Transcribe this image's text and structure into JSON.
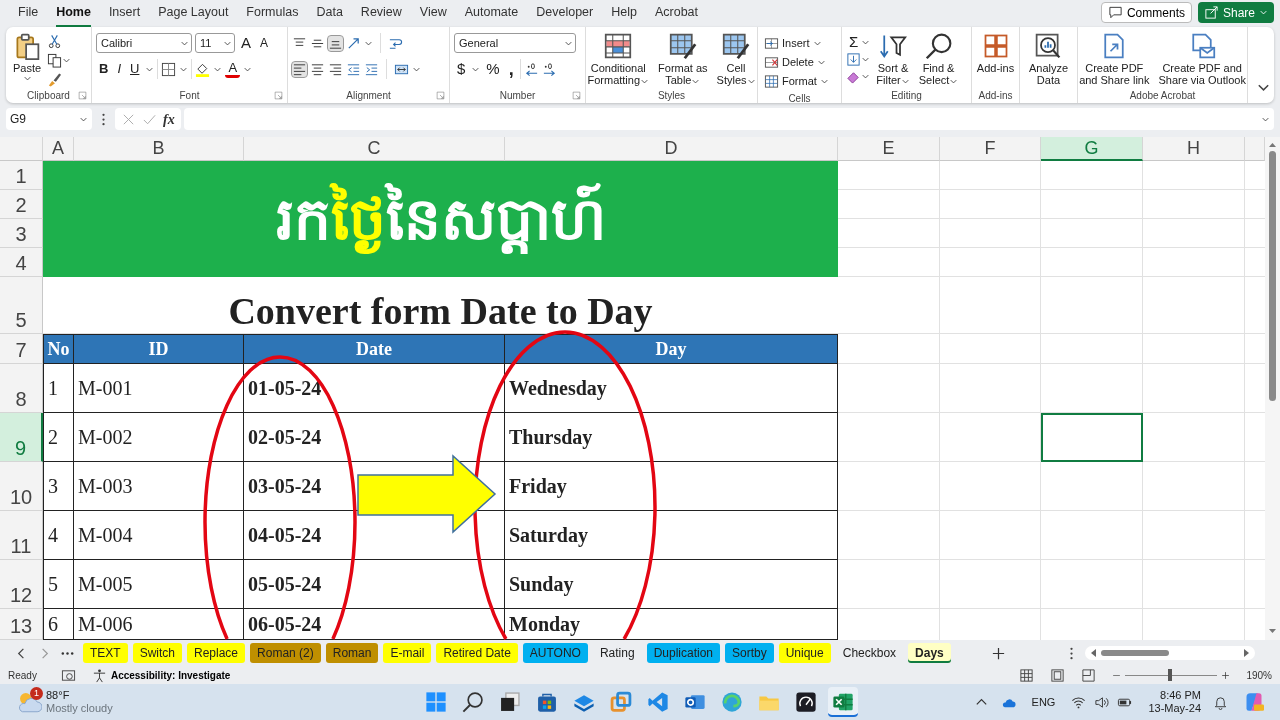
{
  "menu_tabs": [
    {
      "label": "File",
      "selected": false
    },
    {
      "label": "Home",
      "selected": true
    },
    {
      "label": "Insert",
      "selected": false
    },
    {
      "label": "Page Layout",
      "selected": false
    },
    {
      "label": "Formulas",
      "selected": false
    },
    {
      "label": "Data",
      "selected": false
    },
    {
      "label": "Review",
      "selected": false
    },
    {
      "label": "View",
      "selected": false
    },
    {
      "label": "Automate",
      "selected": false
    },
    {
      "label": "Developer",
      "selected": false
    },
    {
      "label": "Help",
      "selected": false
    },
    {
      "label": "Acrobat",
      "selected": false
    }
  ],
  "header_buttons": {
    "comments": "Comments",
    "share": "Share"
  },
  "ribbon": {
    "clipboard": {
      "paste": "Paste",
      "label": "Clipboard"
    },
    "font": {
      "name": "Calibri",
      "size": "11",
      "grow": "A",
      "shrink": "A",
      "bold": "B",
      "italic": "I",
      "underline": "U",
      "font_color_button": "A",
      "label": "Font"
    },
    "alignment": {
      "vertical": [
        {
          "selected": false
        },
        {
          "selected": false
        },
        {
          "selected": true
        }
      ],
      "horizontal": [
        {
          "selected": true
        },
        {
          "selected": false
        },
        {
          "selected": false
        }
      ],
      "label": "Alignment"
    },
    "number": {
      "format": "General",
      "currency": "$",
      "percent": "%",
      "comma": ",",
      "label": "Number"
    },
    "styles": {
      "conditional": [
        "Conditional",
        "Formatting"
      ],
      "format_table": [
        "Format as",
        "Table"
      ],
      "cell_styles": [
        "Cell",
        "Styles"
      ],
      "label": "Styles"
    },
    "cells": {
      "insert": "Insert",
      "delete": "Delete",
      "format": "Format",
      "label": "Cells"
    },
    "editing": {
      "sum": "Σ",
      "sort": [
        "Sort &",
        "Filter"
      ],
      "find": [
        "Find &",
        "Select"
      ],
      "label": "Editing"
    },
    "addins": {
      "button": "Add-ins",
      "label": "Add-ins"
    },
    "analyze": [
      "Analyze",
      "Data"
    ],
    "acrobat": {
      "share_link": [
        "Create PDF",
        "and Share link"
      ],
      "outlook": [
        "Create PDF and",
        "Share via Outlook"
      ],
      "label": "Adobe Acrobat"
    }
  },
  "formula_bar": {
    "name_box": "G9",
    "fx": "fx"
  },
  "columns": [
    {
      "label": "A",
      "selected": false
    },
    {
      "label": "B",
      "selected": false
    },
    {
      "label": "C",
      "selected": false
    },
    {
      "label": "D",
      "selected": false
    },
    {
      "label": "E",
      "selected": false
    },
    {
      "label": "F",
      "selected": false
    },
    {
      "label": "G",
      "selected": true
    },
    {
      "label": "H",
      "selected": false
    }
  ],
  "rows": [
    {
      "label": "1",
      "selected": false
    },
    {
      "label": "2",
      "selected": false
    },
    {
      "label": "3",
      "selected": false
    },
    {
      "label": "4",
      "selected": false
    },
    {
      "label": "5",
      "selected": false
    },
    {
      "label": "7",
      "selected": false
    },
    {
      "label": "8",
      "selected": false
    },
    {
      "label": "9",
      "selected": true
    },
    {
      "label": "10",
      "selected": false
    },
    {
      "label": "11",
      "selected": false
    },
    {
      "label": "12",
      "selected": false
    },
    {
      "label": "13",
      "selected": false
    }
  ],
  "sheet": {
    "banner": [
      {
        "text": "រក",
        "color": "#ffffff"
      },
      {
        "text": "ថ្ងៃ",
        "color": "#ffff00"
      },
      {
        "text": "នៃសប្តាហ៍",
        "color": "#ffffff"
      }
    ],
    "title": "Convert form Date to Day",
    "headers": [
      "No",
      "ID",
      "Date",
      "Day"
    ],
    "records": [
      [
        "1",
        "M-001",
        "01-05-24",
        "Wednesday"
      ],
      [
        "2",
        "M-002",
        "02-05-24",
        "Thursday"
      ],
      [
        "3",
        "M-003",
        "03-05-24",
        "Friday"
      ],
      [
        "4",
        "M-004",
        "04-05-24",
        "Saturday"
      ],
      [
        "5",
        "M-005",
        "05-05-24",
        "Sunday"
      ],
      [
        "6",
        "M-006",
        "06-05-24",
        "Monday"
      ]
    ]
  },
  "sheet_tabs": [
    {
      "label": "TEXT",
      "color": "#ffff00",
      "selected": false
    },
    {
      "label": "Switch",
      "color": "#ffff00",
      "selected": false
    },
    {
      "label": "Replace",
      "color": "#ffff00",
      "selected": false
    },
    {
      "label": "Roman (2)",
      "color": "#bf8f00",
      "selected": false
    },
    {
      "label": "Roman",
      "color": "#bf8f00",
      "selected": false
    },
    {
      "label": "E-mail",
      "color": "#ffff00",
      "selected": false
    },
    {
      "label": "Retired Date",
      "color": "#ffff00",
      "selected": false
    },
    {
      "label": "AUTONO",
      "color": "#00b0f0",
      "selected": false
    },
    {
      "label": "Rating",
      "selected": false
    },
    {
      "label": "Duplication",
      "color": "#00b0f0",
      "selected": false
    },
    {
      "label": "Sortby",
      "color": "#00b0f0",
      "selected": false
    },
    {
      "label": "Unique",
      "color": "#ffff00",
      "selected": false
    },
    {
      "label": "Checkbox",
      "selected": false
    },
    {
      "label": "Days",
      "color": "#ffffc4",
      "selected": true
    }
  ],
  "status_bar": {
    "mode": "Ready",
    "accessibility": "Accessibility: Investigate",
    "zoom": "190%",
    "zoom_slider": {
      "level": 0.48
    }
  },
  "taskbar": {
    "weather": {
      "badge": "1",
      "temperature": "88°F",
      "condition": "Mostly cloudy"
    },
    "language": "ENG",
    "time": "8:46 PM",
    "date": "13-May-24"
  }
}
